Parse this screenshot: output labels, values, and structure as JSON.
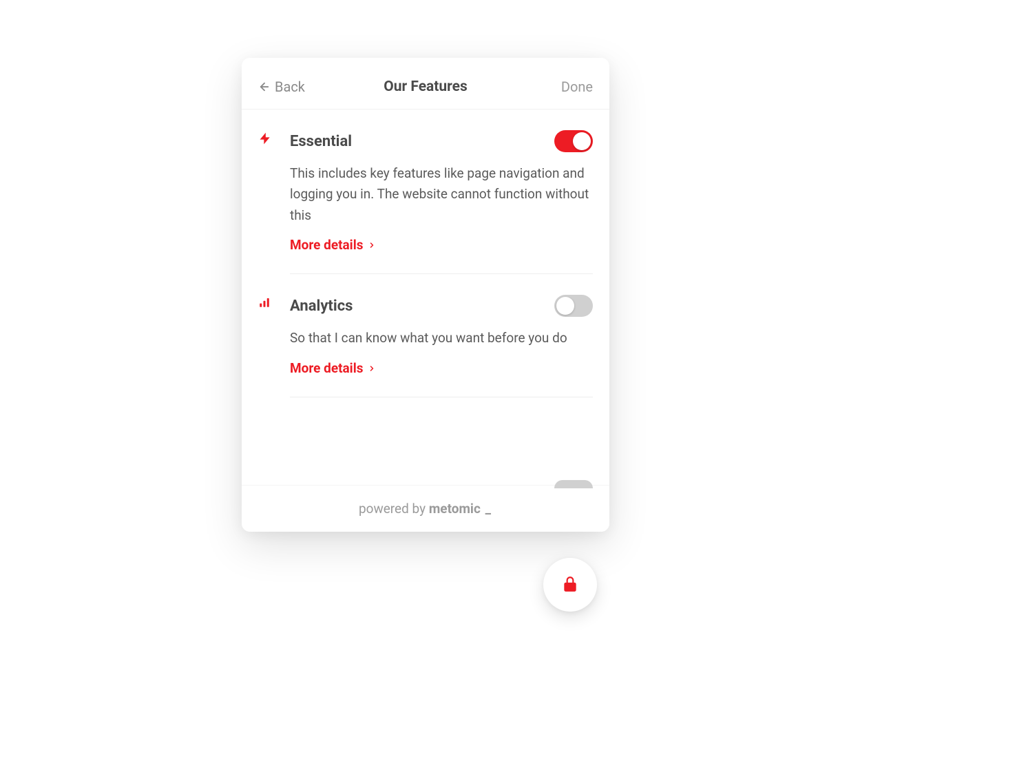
{
  "header": {
    "back_label": "Back",
    "title": "Our Features",
    "done_label": "Done"
  },
  "features": [
    {
      "title": "Essential",
      "description": "This includes key features like page navigation and logging you in. The website cannot function without this",
      "more_label": "More details",
      "toggle_on": true
    },
    {
      "title": "Analytics",
      "description": "So that I can know what you want before you do",
      "more_label": "More details",
      "toggle_on": false
    }
  ],
  "footer": {
    "prefix": "powered by ",
    "brand": "metomic",
    "suffix": " _"
  },
  "colors": {
    "accent": "#ed1c24"
  }
}
